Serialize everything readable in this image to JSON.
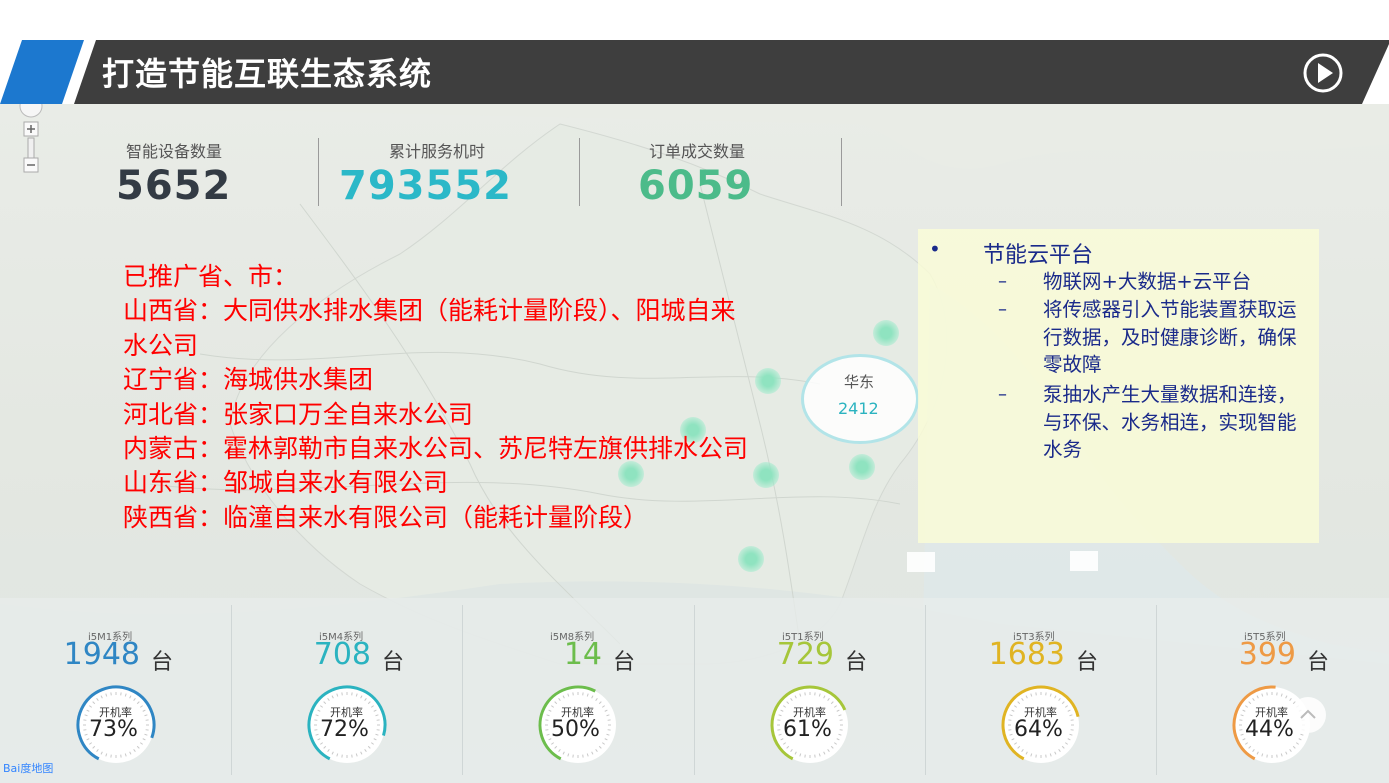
{
  "header": {
    "title": "打造节能互联生态系统"
  },
  "stats": [
    {
      "label": "智能设备数量",
      "value": "5652",
      "color": "#333b44"
    },
    {
      "label": "累计服务机时",
      "value": "793552",
      "color": "#2bb8c8"
    },
    {
      "label": "订单成交数量",
      "value": "6059",
      "color": "#4cbb8a"
    }
  ],
  "promotion": {
    "heading": "已推广省、市：",
    "lines": [
      "山西省：大同供水排水集团（能耗计量阶段）、阳城自来",
      "水公司",
      "辽宁省：海城供水集团",
      "河北省：张家口万全自来水公司",
      "内蒙古：霍林郭勒市自来水公司、苏尼特左旗供排水公司",
      "山东省：邹城自来水有限公司",
      "陕西省：临潼自来水有限公司（能耗计量阶段）"
    ]
  },
  "map_bubble": {
    "region": "华东",
    "count": "2412"
  },
  "cloud_platform": {
    "bullet": "•",
    "title": "节能云平台",
    "dash": "–",
    "items": [
      "物联网+大数据+云平台",
      "将传感器引入节能装置获取运行数据，及时健康诊断，确保零故障",
      "泵抽水产生大量数据和连接，与环保、水务相连，实现智能水务"
    ]
  },
  "metrics": {
    "unit": "台",
    "rate_label": "开机率",
    "items": [
      {
        "series": "i5M1系列",
        "count": "1948",
        "rate": "73%",
        "rate_value": 73,
        "color": "#2f86c4"
      },
      {
        "series": "i5M4系列",
        "count": "708",
        "rate": "72%",
        "rate_value": 72,
        "color": "#2bb3c0"
      },
      {
        "series": "i5M8系列",
        "count": "14",
        "rate": "50%",
        "rate_value": 50,
        "color": "#6cbd4c"
      },
      {
        "series": "i5T1系列",
        "count": "729",
        "rate": "61%",
        "rate_value": 61,
        "color": "#a6c63a"
      },
      {
        "series": "i5T3系列",
        "count": "1683",
        "rate": "64%",
        "rate_value": 64,
        "color": "#e0b423"
      },
      {
        "series": "i5T5系列",
        "count": "399",
        "rate": "44%",
        "rate_value": 44,
        "color": "#ee9a45"
      }
    ]
  },
  "map_logo": {
    "text": "Bai度地图"
  },
  "colors": {
    "banner_dark": "#3e3e3e",
    "banner_blue": "#1c78cf",
    "promo_red": "#ff0000",
    "cloud_text": "#1a2a8a"
  }
}
